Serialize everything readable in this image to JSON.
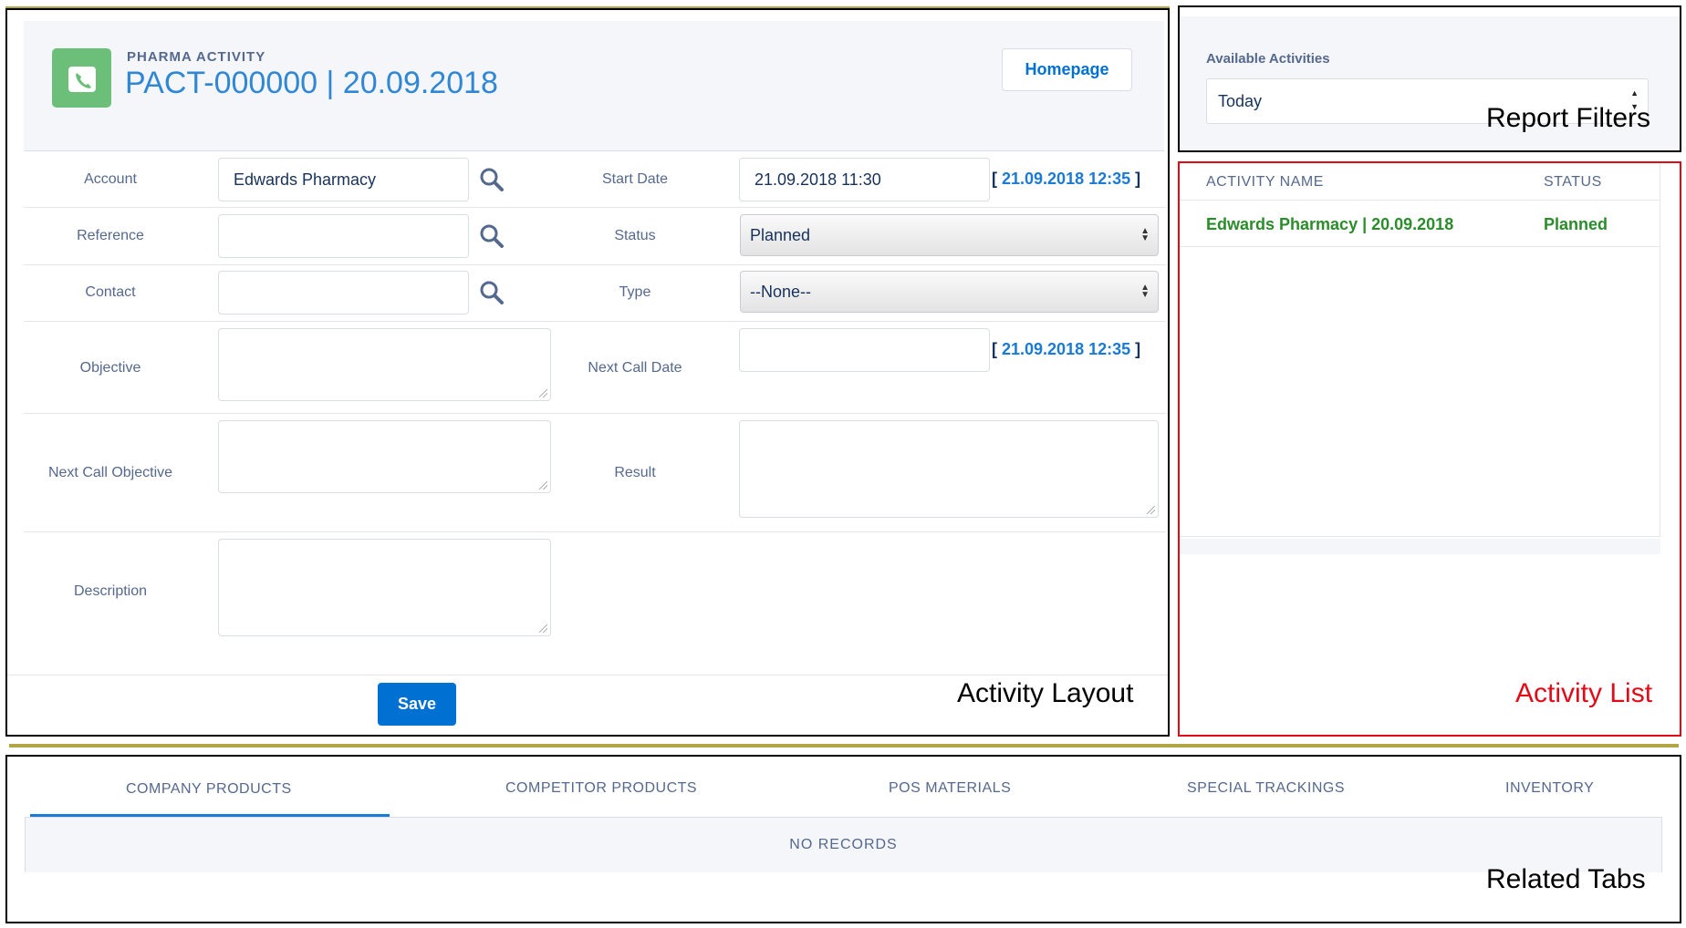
{
  "activity": {
    "object_label": "PHARMA ACTIVITY",
    "record_title": "PACT-000000 | 20.09.2018",
    "homepage_label": "Homepage",
    "fields": {
      "account_label": "Account",
      "account_value": "Edwards Pharmacy",
      "reference_label": "Reference",
      "contact_label": "Contact",
      "objective_label": "Objective",
      "next_call_objective_label": "Next Call Objective",
      "description_label": "Description",
      "start_date_label": "Start Date",
      "start_date_value": "21.09.2018 11:30",
      "start_date_link": "21.09.2018 12:35",
      "status_label": "Status",
      "status_value": "Planned",
      "type_label": "Type",
      "type_value": "--None--",
      "next_call_date_label": "Next Call Date",
      "next_call_date_link": "21.09.2018 12:35",
      "result_label": "Result"
    },
    "save_label": "Save",
    "section_caption": "Activity Layout"
  },
  "filters": {
    "label": "Available Activities",
    "selected": "Today",
    "section_caption": "Report Filters"
  },
  "activity_list": {
    "columns": [
      "ACTIVITY NAME",
      "STATUS"
    ],
    "rows": [
      {
        "name": "Edwards Pharmacy | 20.09.2018",
        "status": "Planned"
      }
    ],
    "section_caption": "Activity List"
  },
  "related_tabs": {
    "tabs": [
      "COMPANY PRODUCTS",
      "COMPETITOR PRODUCTS",
      "POS MATERIALS",
      "SPECIAL TRACKINGS",
      "INVENTORY"
    ],
    "active_tab": "COMPANY PRODUCTS",
    "empty_text": "NO RECORDS",
    "section_caption": "Related Tabs"
  },
  "colors": {
    "accent": "#0070d2",
    "link": "#1a7ad4",
    "list_text": "#2a8c2a",
    "caption_red": "#e30a17",
    "separator_gold": "#b0a646",
    "app_icon": "#6cbf79"
  },
  "icons": [
    "phone-icon",
    "search-icon",
    "select-arrows-icon"
  ]
}
